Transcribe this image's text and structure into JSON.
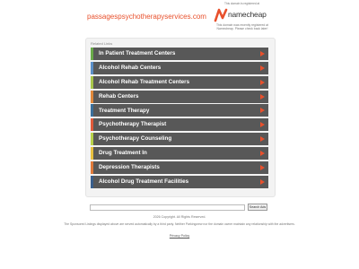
{
  "header": {
    "domain": "passagespsychotherapyservices.com"
  },
  "namecheap": {
    "note_top": "This domain is registered at",
    "logo_text": "namecheap",
    "note": "This domain was recently registered at Namecheap. Please check back later!",
    "brand_color": "#e8502c"
  },
  "related": {
    "title": "Related Links",
    "items": [
      {
        "label": "In Patient Treatment Centers",
        "accent": "#6aab4a"
      },
      {
        "label": "Alcohol Rehab Centers",
        "accent": "#5b8fc7"
      },
      {
        "label": "Alcohol Rehab Treatment Centers",
        "accent": "#a8c64a"
      },
      {
        "label": "Rehab Centers",
        "accent": "#e0883a"
      },
      {
        "label": "Treatment Therapy",
        "accent": "#3a6f9c"
      },
      {
        "label": "Psychotherapy Therapist",
        "accent": "#e05a3a"
      },
      {
        "label": "Psychotherapy Counseling",
        "accent": "#b9d24a"
      },
      {
        "label": "Drug Treatment In",
        "accent": "#e8c040"
      },
      {
        "label": "Depression Therapists",
        "accent": "#e07a3a"
      },
      {
        "label": "Alcohol Drug Treatment Facilities",
        "accent": "#3a5f8c"
      }
    ]
  },
  "search": {
    "value": "",
    "button_label": "Search Ads"
  },
  "footer": {
    "copyright": "2026 Copyright. All Rights Reserved.",
    "sponsored": "The Sponsored Listings displayed above are served automatically by a third party. Neither Parkingcrew nor the domain owner maintain any relationship with the advertisers.",
    "privacy": "Privacy Policy"
  }
}
